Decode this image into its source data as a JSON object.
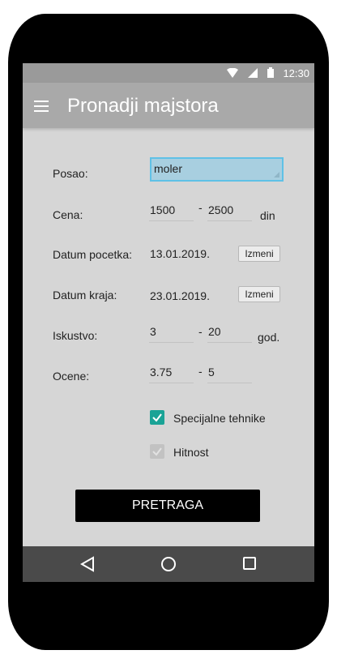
{
  "status": {
    "time": "12:30",
    "icons": [
      "wifi-icon",
      "signal-icon",
      "battery-icon"
    ]
  },
  "appbar": {
    "title": "Pronadji majstora",
    "menu_icon": "menu-icon"
  },
  "form": {
    "posao": {
      "label": "Posao:",
      "value": "moler"
    },
    "cena": {
      "label": "Cena:",
      "from": "1500",
      "dash": "-",
      "to": "2500",
      "unit": "din"
    },
    "datum_pocetka": {
      "label": "Datum pocetka:",
      "value": "13.01.2019.",
      "button": "Izmeni"
    },
    "datum_kraja": {
      "label": "Datum kraja:",
      "value": "23.01.2019.",
      "button": "Izmeni"
    },
    "iskustvo": {
      "label": "Iskustvo:",
      "from": "3",
      "dash": "-",
      "to": "20",
      "unit": "god."
    },
    "ocene": {
      "label": "Ocene:",
      "from": "3.75",
      "dash": "-",
      "to": "5"
    },
    "checkboxes": [
      {
        "label": "Specijalne tehnike",
        "checked": true,
        "enabled": true
      },
      {
        "label": "Hitnost",
        "checked": true,
        "enabled": false
      }
    ],
    "search_button": "PRETRAGA"
  },
  "navbar": {
    "icons": [
      "back-icon",
      "home-icon",
      "recents-icon"
    ]
  },
  "colors": {
    "accent": "#1aa396",
    "appbar": "#a9a9a9",
    "statusbar": "#9a9a9a",
    "navbar": "#4a4a4a",
    "dropdown": "#a8cfe0"
  }
}
